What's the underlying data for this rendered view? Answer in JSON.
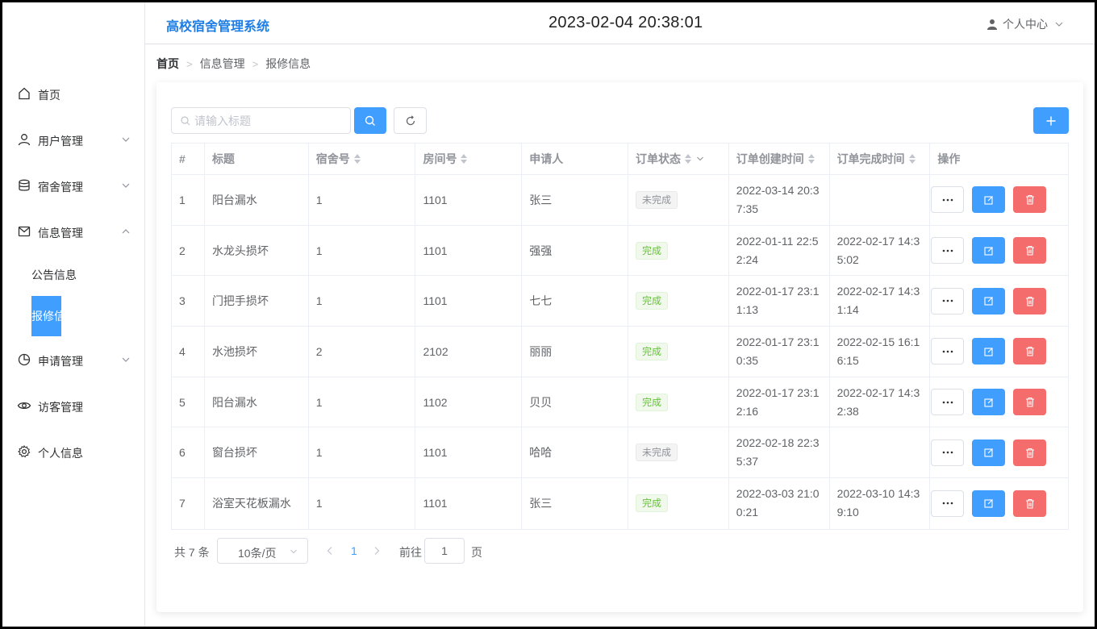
{
  "app": {
    "title": "高校宿舍管理系统",
    "clock": "2023-02-04 20:38:01",
    "user_menu": "个人中心"
  },
  "sidebar": {
    "items": [
      {
        "label": "首页",
        "icon": "home-icon"
      },
      {
        "label": "用户管理",
        "icon": "user-icon"
      },
      {
        "label": "宿舍管理",
        "icon": "database-icon"
      },
      {
        "label": "信息管理",
        "icon": "message-icon"
      },
      {
        "label": "申请管理",
        "icon": "pie-chart-icon"
      },
      {
        "label": "访客管理",
        "icon": "eye-icon"
      },
      {
        "label": "个人信息",
        "icon": "gear-icon"
      }
    ],
    "sub_items": [
      {
        "label": "公告信息"
      },
      {
        "label": "报修信息"
      }
    ]
  },
  "breadcrumb": [
    "首页",
    "信息管理",
    "报修信息"
  ],
  "toolbar": {
    "search_placeholder": "请输入标题"
  },
  "table": {
    "columns": [
      "#",
      "标题",
      "宿舍号",
      "房间号",
      "申请人",
      "订单状态",
      "订单创建时间",
      "订单完成时间",
      "操作"
    ],
    "rows": [
      {
        "id": "1",
        "title": "阳台漏水",
        "dorm": "1",
        "room": "1101",
        "applicant": "张三",
        "status": "未完成",
        "created": "2022-03-14 20:37:35",
        "finished": ""
      },
      {
        "id": "2",
        "title": "水龙头损坏",
        "dorm": "1",
        "room": "1101",
        "applicant": "强强",
        "status": "完成",
        "created": "2022-01-11 22:52:24",
        "finished": "2022-02-17 14:35:02"
      },
      {
        "id": "3",
        "title": "门把手损坏",
        "dorm": "1",
        "room": "1101",
        "applicant": "七七",
        "status": "完成",
        "created": "2022-01-17 23:11:13",
        "finished": "2022-02-17 14:31:14"
      },
      {
        "id": "4",
        "title": "水池损坏",
        "dorm": "2",
        "room": "2102",
        "applicant": "丽丽",
        "status": "完成",
        "created": "2022-01-17 23:10:35",
        "finished": "2022-02-15 16:16:15"
      },
      {
        "id": "5",
        "title": "阳台漏水",
        "dorm": "1",
        "room": "1102",
        "applicant": "贝贝",
        "status": "完成",
        "created": "2022-01-17 23:12:16",
        "finished": "2022-02-17 14:32:38"
      },
      {
        "id": "6",
        "title": "窗台损坏",
        "dorm": "1",
        "room": "1101",
        "applicant": "哈哈",
        "status": "未完成",
        "created": "2022-02-18 22:35:37",
        "finished": ""
      },
      {
        "id": "7",
        "title": "浴室天花板漏水",
        "dorm": "1",
        "room": "1101",
        "applicant": "张三",
        "status": "完成",
        "created": "2022-03-03 21:00:21",
        "finished": "2022-03-10 14:39:10"
      }
    ]
  },
  "pagination": {
    "total_text": "共 7 条",
    "page_size": "10条/页",
    "current_page": "1",
    "goto_label": "前往",
    "goto_value": "1",
    "page_suffix": "页"
  },
  "colors": {
    "primary": "#409eff",
    "danger": "#f56c6c",
    "success": "#67c23a",
    "title": "#1f7ee6"
  }
}
